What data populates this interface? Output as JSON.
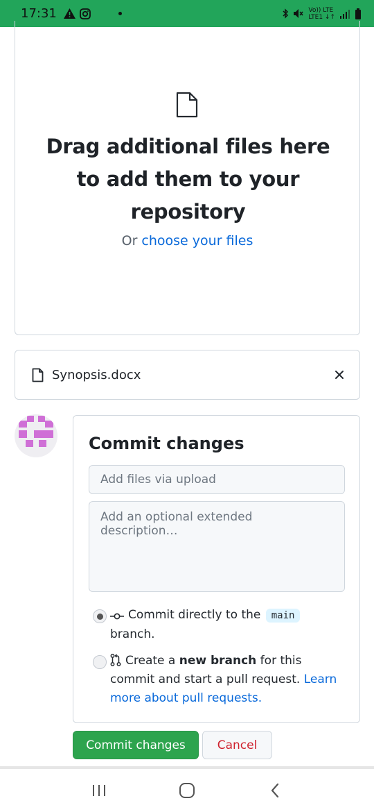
{
  "status_bar": {
    "time": "17:31",
    "network_top": "Vo)) LTE",
    "network_bottom": "LTE1 ↓↑"
  },
  "dropzone": {
    "title": "Drag additional files here to add them to your repository",
    "or_text": "Or ",
    "choose_link": "choose your files"
  },
  "file": {
    "name": "Synopsis.docx"
  },
  "commit": {
    "title": "Commit changes",
    "summary_placeholder": "Add files via upload",
    "description_placeholder": "Add an optional extended description…",
    "option1_prefix": "Commit directly to the",
    "branch": "main",
    "option1_suffix": "branch.",
    "option2_prefix": "Create a ",
    "option2_bold": "new branch",
    "option2_mid": " for this commit and start a pull request. ",
    "option2_link": "Learn more about pull requests",
    "option2_end": "."
  },
  "buttons": {
    "commit": "Commit changes",
    "cancel": "Cancel"
  },
  "colors": {
    "status_bar": "#22a55a",
    "link": "#0969da",
    "commit_button": "#2da44e",
    "cancel_text": "#cf222e",
    "avatar": "#cf6fd6"
  }
}
